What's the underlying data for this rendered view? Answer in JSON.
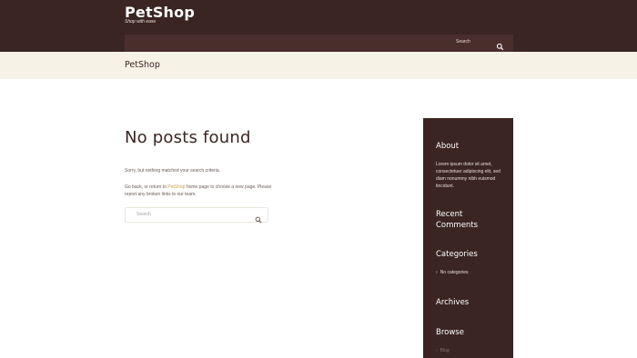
{
  "header": {
    "site_title": "PetShop",
    "tagline": "Shop with ease",
    "search_label": "Search"
  },
  "titlebar": {
    "title": "PetShop"
  },
  "main": {
    "heading": "No posts found",
    "message1": "Sorry, but nothing matched your search criteria.",
    "message2_before": "Go back, or return to ",
    "message2_link": "PetShop",
    "message2_after": " home page to choose a new page. Please report any broken links to our team.",
    "search_placeholder": "Search"
  },
  "sidebar": {
    "about_title": "About",
    "about_text": "Lorem ipsum dolor sit amet, consectetuer adipiscing elit, sed diam nonummy nibh euismod tincidunt.",
    "recent_title_line1": "Recent",
    "recent_title_line2": "Comments",
    "categories_title": "Categories",
    "categories_item": "No categories",
    "archives_title": "Archives",
    "browse_title": "Browse",
    "browse_item": "Blog"
  },
  "colors": {
    "header_bg": "#3a2523",
    "nav_bg": "#4a2e2c",
    "titlebar_bg": "#f7f2e6",
    "link": "#c8a24b"
  },
  "icons": [
    "search-icon",
    "arrow-right-icon"
  ]
}
